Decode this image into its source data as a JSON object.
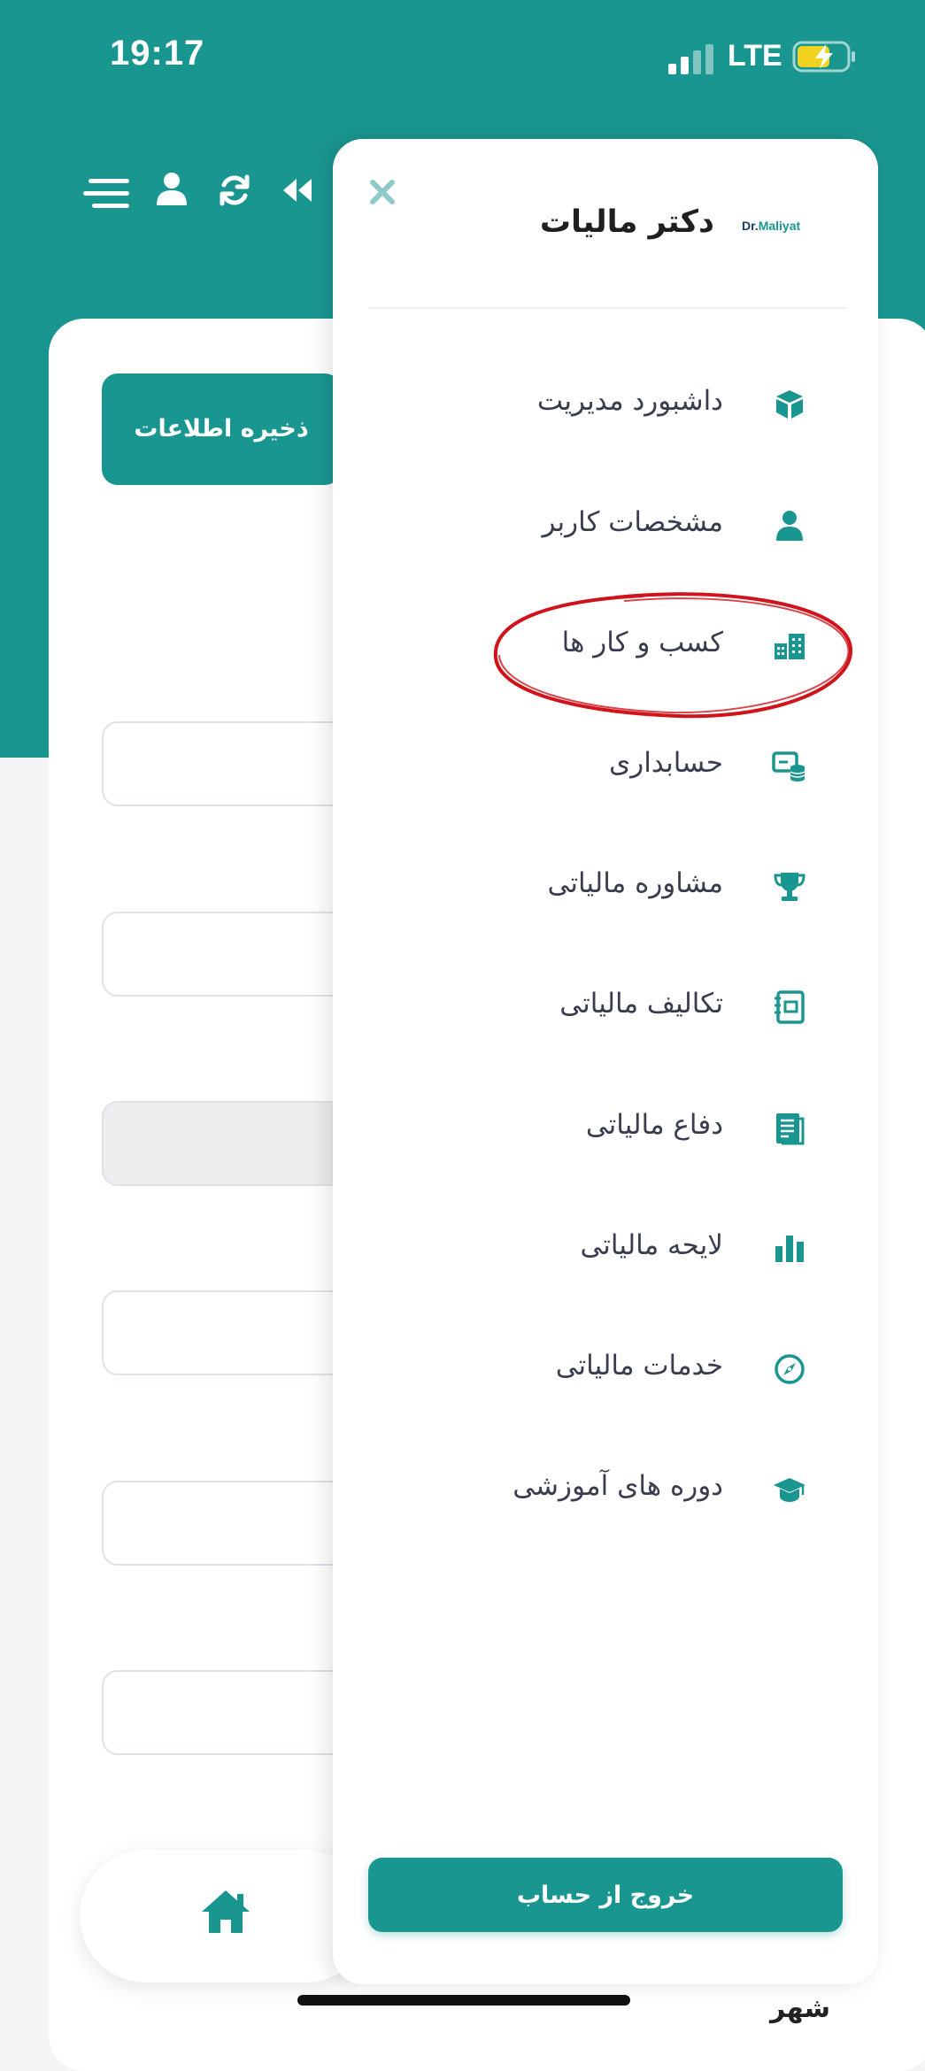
{
  "status_bar": {
    "time": "19:17",
    "network": "LTE"
  },
  "background_page": {
    "save_button_label": "ذخیره اطلاعات",
    "bottom_label": "شهر"
  },
  "drawer": {
    "brand_logo_prefix": "Dr.",
    "brand_logo_name": "Maliyat",
    "brand_title": "دکتر مالیات",
    "items": [
      {
        "label": "داشبورد مدیریت",
        "icon": "cube-icon"
      },
      {
        "label": "مشخصات کاربر",
        "icon": "user-icon"
      },
      {
        "label": "کسب و کار ها",
        "icon": "building-icon"
      },
      {
        "label": "حسابداری",
        "icon": "accounting-icon"
      },
      {
        "label": "مشاوره مالیاتی",
        "icon": "trophy-icon"
      },
      {
        "label": "تکالیف مالیاتی",
        "icon": "notebook-icon"
      },
      {
        "label": "دفاع مالیاتی",
        "icon": "document-icon"
      },
      {
        "label": "لایحه مالیاتی",
        "icon": "bar-chart-icon"
      },
      {
        "label": "خدمات مالیاتی",
        "icon": "compass-icon"
      },
      {
        "label": "دوره های آموزشی",
        "icon": "graduation-cap-icon"
      }
    ],
    "logout_label": "خروج از حساب"
  },
  "colors": {
    "accent": "#1a9690",
    "annotation": "#d0141c"
  }
}
